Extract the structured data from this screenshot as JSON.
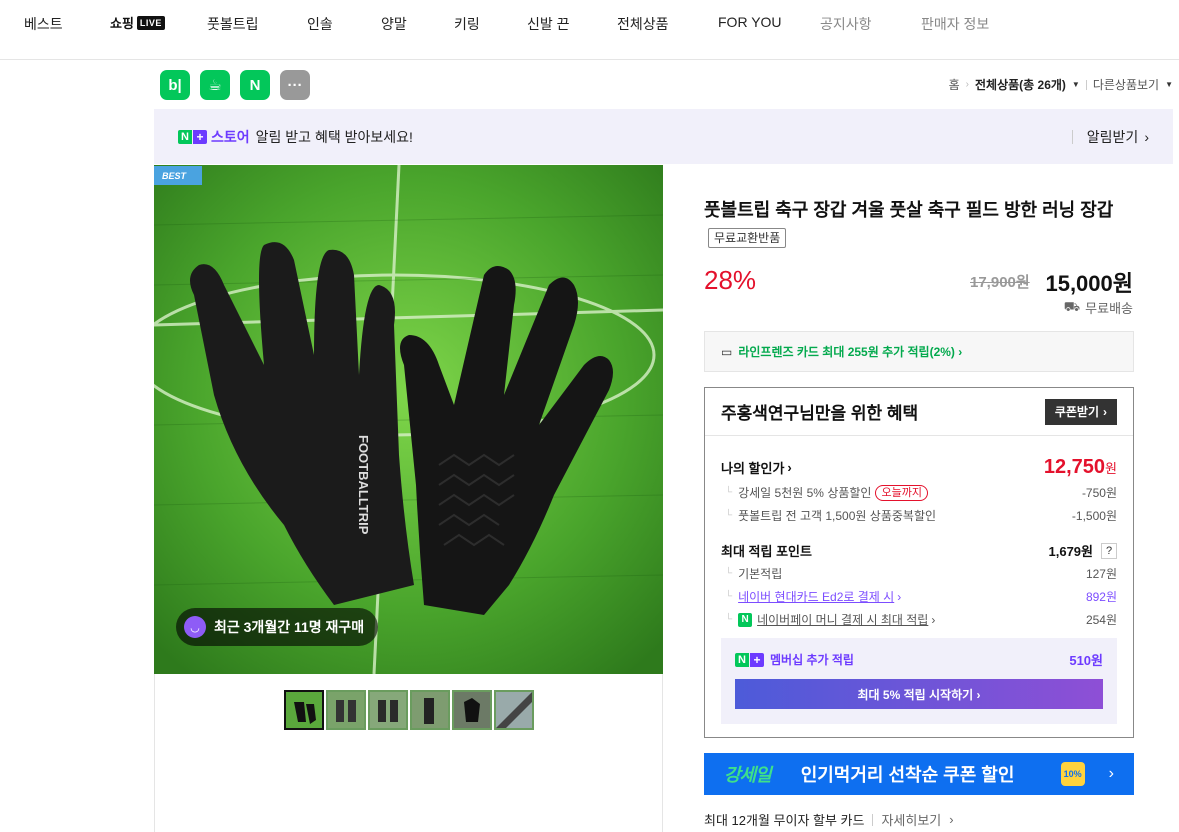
{
  "nav": {
    "items": [
      "베스트",
      "쇼핑",
      "풋볼트립",
      "인솔",
      "양말",
      "키링",
      "신발 끈",
      "전체상품",
      "FOR YOU",
      "공지사항",
      "판매자 정보"
    ],
    "live_badge": "LIVE"
  },
  "apps": [
    "b|",
    "☕",
    "N",
    "···"
  ],
  "breadcrumb": {
    "home": "홈",
    "current": "전체상품(총 26개)",
    "other": "다른상품보기"
  },
  "alert": {
    "store": "스토어",
    "message": "알림 받고 혜택 받아보세요!",
    "action": "알림받기"
  },
  "gallery": {
    "best_tag": "BEST",
    "repurchase": "최근 3개월간 11명 재구매",
    "product_brand_print": "FOOTBALLTRIP",
    "thumbnails": 6,
    "active_thumbnail": 0
  },
  "product": {
    "title": "풋볼트립 축구 장갑 겨울 풋살 축구 필드 방한 러닝 장갑",
    "badge": "무료교환반품",
    "discount": "28%",
    "original_price": "17,900원",
    "sale_price": "15,000원",
    "shipping": "무료배송"
  },
  "card_benefit": "라인프렌즈 카드 최대 255원 추가 적립(2%) ›",
  "coupon": {
    "heading": "주홍색연구님만을 위한 혜택",
    "button": "쿠폰받기",
    "my_discount_label": "나의 할인가",
    "my_discount_value": "12,750",
    "won": "원",
    "discount_rows": [
      {
        "label": "강세일 5천원 5% 상품할인",
        "tag": "오늘까지",
        "value": "-750원"
      },
      {
        "label": "풋볼트립 전 고객 1,500원 상품중복할인",
        "value": "-1,500원"
      }
    ],
    "points_label": "최대 적립 포인트",
    "points_value": "1,679원",
    "points_rows": [
      {
        "label": "기본적립",
        "value": "127원"
      },
      {
        "label": "네이버 현대카드 Ed2로 결제 시",
        "value": "892원"
      },
      {
        "label": "네이버페이 머니 결제 시 최대 적립",
        "value": "254원"
      }
    ],
    "membership_label": "멤버십 추가 적립",
    "membership_value": "510원",
    "membership_cta": "최대 5% 적립 시작하기 ›"
  },
  "promo": {
    "logo": "강세일",
    "text": "인기먹거리 선착순 쿠폰 할인",
    "gift_label": "10%"
  },
  "installment": {
    "text": "최대 12개월 무이자 할부 카드",
    "more": "자세히보기"
  },
  "colors": {
    "brand_green": "#03c75a",
    "sale_red": "#e4112c",
    "membership_purple": "#6d3bff",
    "promo_blue": "#0e6ff0"
  }
}
